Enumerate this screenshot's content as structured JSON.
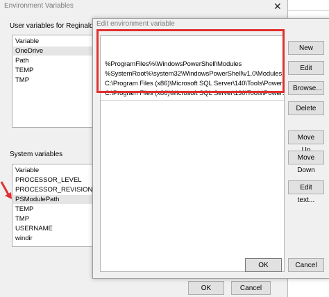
{
  "background_dialog": {
    "title": "Environment Variables",
    "close_glyph": "✕",
    "user_vars_label": "User variables for Reginaldo",
    "user_vars": [
      "Variable",
      "OneDrive",
      "Path",
      "TEMP",
      "TMP"
    ],
    "system_vars_label": "System variables",
    "system_vars": [
      "Variable",
      "PROCESSOR_LEVEL",
      "PROCESSOR_REVISION",
      "PSModulePath",
      "TEMP",
      "TMP",
      "USERNAME",
      "windir"
    ],
    "ok_label": "OK",
    "cancel_label": "Cancel"
  },
  "edit_dialog": {
    "title": "Edit environment variable",
    "paths": [
      "%ProgramFiles%\\WindowsPowerShell\\Modules",
      "%SystemRoot%\\system32\\WindowsPowerShell\\v1.0\\Modules",
      "C:\\Program Files (x86)\\Microsoft SQL Server\\140\\Tools\\PowerSh...",
      "C:\\Program Files (x86)\\Microsoft SQL Server\\130\\Tools\\PowerSh..."
    ],
    "buttons": {
      "new": "New",
      "edit": "Edit",
      "browse": "Browse...",
      "delete": "Delete",
      "move_up": "Move Up",
      "move_down": "Move Down",
      "edit_text": "Edit text..."
    },
    "ok_label": "OK",
    "cancel_label": "Cancel"
  },
  "colors": {
    "highlight_box": "#e0302f",
    "window_bg": "#f0f0f0"
  }
}
